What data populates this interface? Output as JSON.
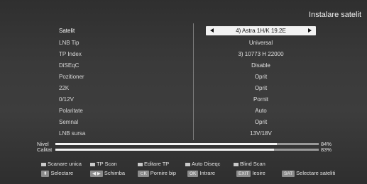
{
  "header": {
    "title": "Instalare satelit"
  },
  "rows": [
    {
      "label": "Satelit",
      "value": "4) Astra 1H/K 19.2E"
    },
    {
      "label": "LNB Tip",
      "value": "Universal"
    },
    {
      "label": "TP Index",
      "value": "3) 10773 H 22000"
    },
    {
      "label": "DiSEqC",
      "value": "Disable"
    },
    {
      "label": "Pozitioner",
      "value": "Oprit"
    },
    {
      "label": "22K",
      "value": "Oprit"
    },
    {
      "label": "0/12V",
      "value": "Pornit"
    },
    {
      "label": "Polaritate",
      "value": "Auto"
    },
    {
      "label": "Semnal",
      "value": "Oprit"
    },
    {
      "label": "LNB sursa",
      "value": "13V/18V"
    }
  ],
  "signal": {
    "nivel_label": "Nivel",
    "nivel_value": 84,
    "nivel_text": "84%",
    "calitat_label": "Calitat",
    "calitat_value": 83,
    "calitat_text": "83%"
  },
  "legend": [
    {
      "label": "Scanare unica",
      "icon": "red-square-icon",
      "color": "#d04040"
    },
    {
      "label": "TP Scan",
      "icon": "green-square-icon",
      "color": "#40a040"
    },
    {
      "label": "Editare TP",
      "icon": "yellow-square-icon",
      "color": "#d0c040"
    },
    {
      "label": "Auto Diseqc",
      "icon": "blue-square-icon",
      "color": "#4060d0"
    },
    {
      "label": "Blind Scan",
      "icon": "white-square-icon",
      "color": "#d0d0d0"
    }
  ],
  "keys": [
    {
      "cap": "⬍",
      "label": "Selectare",
      "icon": "up-down-icon"
    },
    {
      "cap": "◀ ▶",
      "label": "Schimba",
      "icon": "left-right-icon"
    },
    {
      "cap": "⊂K",
      "label": "Pornire bip",
      "icon": "ok-icon"
    },
    {
      "cap": "OK",
      "label": "Intrare",
      "icon": "ok-key-icon"
    },
    {
      "cap": "EXIT",
      "label": "Iesire",
      "icon": "exit-key-icon"
    },
    {
      "cap": "SAT",
      "label": "Selectare sateliti",
      "icon": "sat-key-icon"
    }
  ]
}
